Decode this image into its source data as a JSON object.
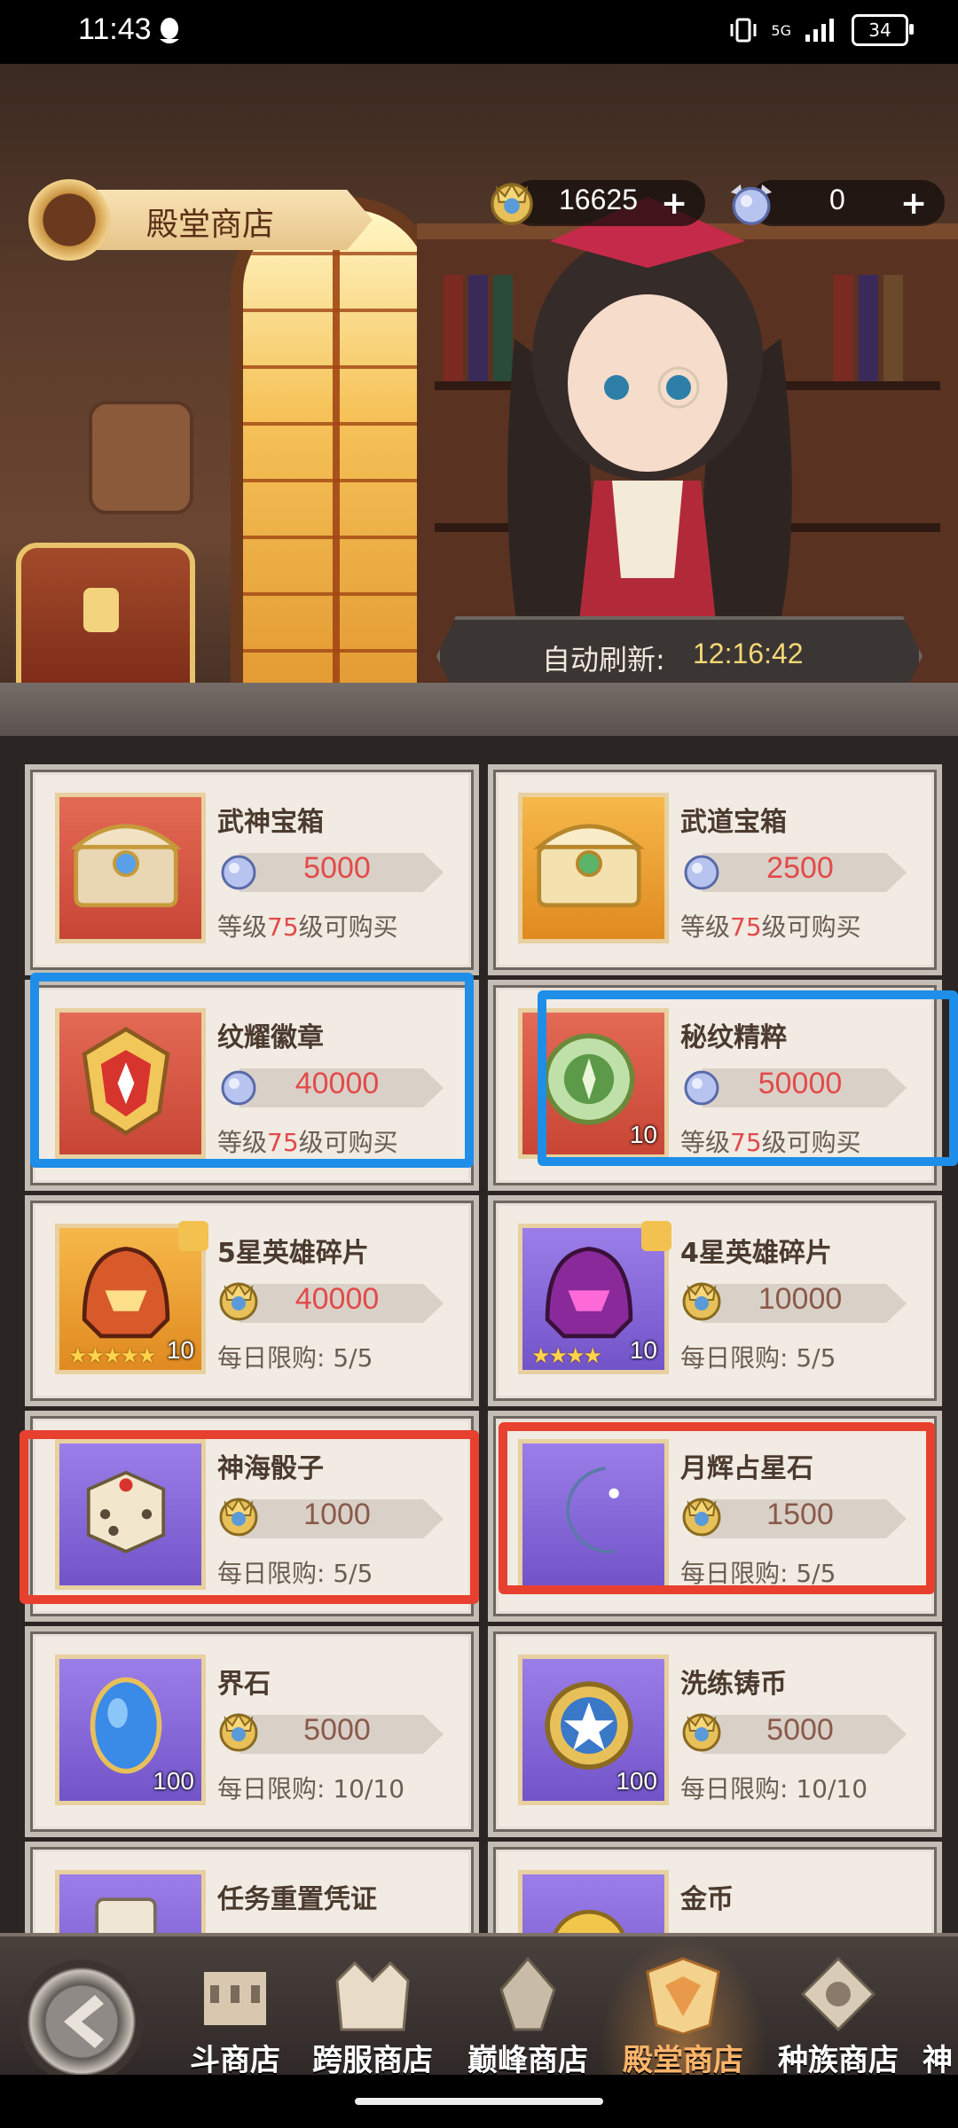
{
  "status": {
    "time": "11:43",
    "network": "5G",
    "battery": "34"
  },
  "header": {
    "shop_title": "殿堂商店"
  },
  "currencies": [
    {
      "icon": "crown-medal-icon",
      "value": "16625"
    },
    {
      "icon": "crystal-orb-icon",
      "value": "0"
    }
  ],
  "refresh": {
    "label": "自动刷新:",
    "time": "12:16:42"
  },
  "items": [
    {
      "name": "武神宝箱",
      "icon": "treasure-chest-icon",
      "currency": "crystal-orb",
      "price": "5000",
      "cond_prefix": "等级",
      "cond_level": "75",
      "cond_suffix": "级可购买"
    },
    {
      "name": "武道宝箱",
      "icon": "treasure-chest-icon",
      "currency": "crystal-orb",
      "price": "2500",
      "cond_prefix": "等级",
      "cond_level": "75",
      "cond_suffix": "级可购买"
    },
    {
      "name": "纹耀徽章",
      "icon": "badge-emblem-icon",
      "currency": "crystal-orb",
      "price": "40000",
      "cond_prefix": "等级",
      "cond_level": "75",
      "cond_suffix": "级可购买"
    },
    {
      "name": "秘纹精粹",
      "icon": "rune-essence-icon",
      "currency": "crystal-orb",
      "price": "50000",
      "qty": "10",
      "cond_prefix": "等级",
      "cond_level": "75",
      "cond_suffix": "级可购买"
    },
    {
      "name": "5星英雄碎片",
      "icon": "hero-helmet-icon",
      "currency": "crown-medal",
      "price": "40000",
      "qty": "10",
      "stars": "★★★★★",
      "limit": "每日限购: 5/5"
    },
    {
      "name": "4星英雄碎片",
      "icon": "hero-helmet-icon",
      "currency": "crown-medal",
      "price": "10000",
      "qty": "10",
      "stars": "★★★★",
      "limit": "每日限购: 5/5"
    },
    {
      "name": "神海骰子",
      "icon": "dice-icon",
      "currency": "crown-medal",
      "price": "1000",
      "limit": "每日限购: 5/5"
    },
    {
      "name": "月辉占星石",
      "icon": "moon-stone-icon",
      "currency": "crown-medal",
      "price": "1500",
      "limit": "每日限购: 5/5"
    },
    {
      "name": "界石",
      "icon": "blue-gem-icon",
      "currency": "crown-medal",
      "price": "5000",
      "qty": "100",
      "limit": "每日限购: 10/10"
    },
    {
      "name": "洗练铸币",
      "icon": "star-coin-icon",
      "currency": "crown-medal",
      "price": "5000",
      "qty": "100",
      "limit": "每日限购: 10/10"
    },
    {
      "name": "任务重置凭证",
      "icon": "scroll-icon"
    },
    {
      "name": "金币",
      "icon": "gold-coin-icon"
    }
  ],
  "nav": [
    {
      "label": "斗商店",
      "icon": "colosseum-icon"
    },
    {
      "label": "跨服商店",
      "icon": "crown-gate-icon"
    },
    {
      "label": "巅峰商店",
      "icon": "peak-emblem-icon"
    },
    {
      "label": "殿堂商店",
      "icon": "hall-emblem-icon",
      "active": true
    },
    {
      "label": "种族商店",
      "icon": "race-emblem-icon"
    },
    {
      "label": "神",
      "icon": "partial-icon"
    }
  ]
}
